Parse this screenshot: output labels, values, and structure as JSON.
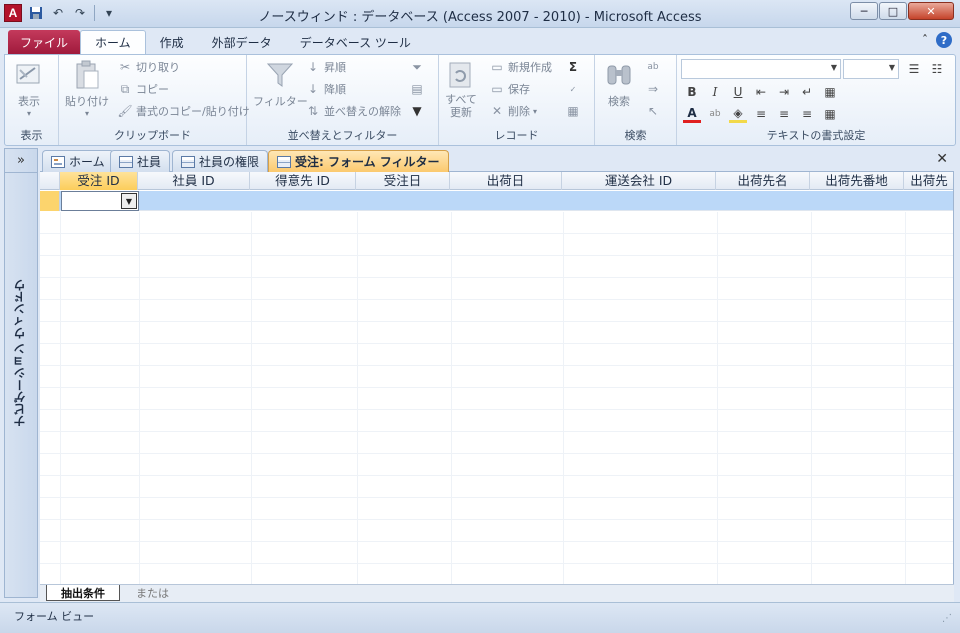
{
  "window": {
    "title": "ノースウィンド : データベース (Access 2007 - 2010)  -  Microsoft Access",
    "app_icon_letter": "A",
    "minimize": "─",
    "maximize": "□",
    "close": "✕"
  },
  "ribbon_tabs": [
    "ファイル",
    "ホーム",
    "作成",
    "外部データ",
    "データベース ツール"
  ],
  "ribbon_right": {
    "collapse": "ˆ",
    "help": "?"
  },
  "ribbon": {
    "view": {
      "label": "表示",
      "group": "表示"
    },
    "clipboard": {
      "paste": "貼り付け",
      "cut": "切り取り",
      "copy": "コピー",
      "format_painter": "書式のコピー/貼り付け",
      "group": "クリップボード"
    },
    "sort_filter": {
      "filter": "フィルター",
      "ascending": "昇順",
      "descending": "降順",
      "clear_sort": "並べ替えの解除",
      "group": "並べ替えとフィルター"
    },
    "records": {
      "refresh_all": "すべて\n更新",
      "new": "新規作成",
      "save": "保存",
      "delete": "削除",
      "group": "レコード"
    },
    "find": {
      "find": "検索",
      "group": "検索"
    },
    "text_format": {
      "bold": "B",
      "italic": "I",
      "underline": "U",
      "group": "テキストの書式設定"
    }
  },
  "nav": {
    "toggle": "»",
    "label": "ナビゲーション ウィンドウ"
  },
  "doc_tabs": [
    "ホーム",
    "社員",
    "社員の権限",
    "受注: フォーム フィルター"
  ],
  "doc_close": "✕",
  "columns": [
    "受注 ID",
    "社員 ID",
    "得意先 ID",
    "受注日",
    "出荷日",
    "運送会社 ID",
    "出荷先名",
    "出荷先番地",
    "出荷先"
  ],
  "bottom_tabs": [
    "抽出条件",
    "または"
  ],
  "status": {
    "text": "フォーム ビュー"
  }
}
